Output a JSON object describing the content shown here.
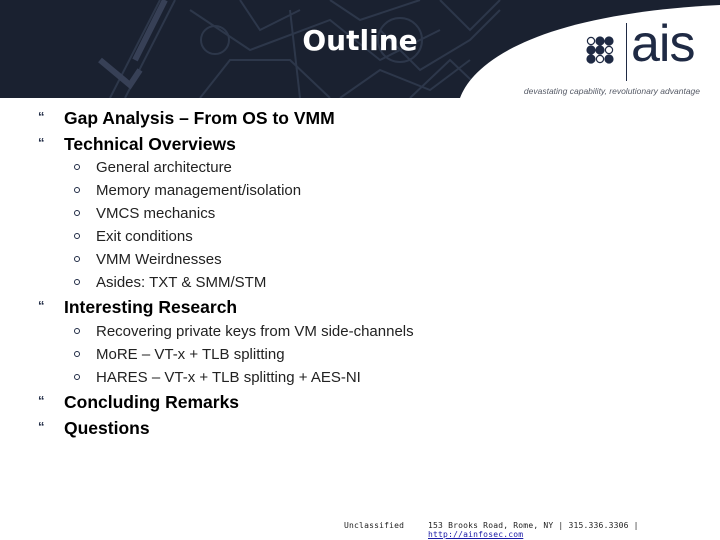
{
  "slide": {
    "title": "Outline",
    "brand": {
      "logo_text": "ais",
      "tagline": "devastating capability, revolutionary advantage",
      "colors": {
        "header_bg": "#1a2130",
        "brand_navy": "#1f2a44"
      }
    },
    "outline": [
      {
        "label": "Gap Analysis – From OS to VMM",
        "children": []
      },
      {
        "label": "Technical Overviews",
        "children": [
          "General architecture",
          "Memory management/isolation",
          "VMCS mechanics",
          "Exit conditions",
          "VMM Weirdnesses",
          "Asides: TXT & SMM/STM"
        ]
      },
      {
        "label": "Interesting Research",
        "children": [
          "Recovering private keys from VM side-channels",
          "MoRE – VT-x + TLB splitting",
          "HARES – VT-x + TLB splitting + AES-NI"
        ]
      },
      {
        "label": "Concluding Remarks",
        "children": []
      },
      {
        "label": "Questions",
        "children": []
      }
    ],
    "bullet_l1_glyph": "“",
    "footer": {
      "classification": "Unclassified",
      "address": "153 Brooks Road, Rome, NY | 315.336.3306 |",
      "link": "http://ainfosec.com"
    }
  }
}
